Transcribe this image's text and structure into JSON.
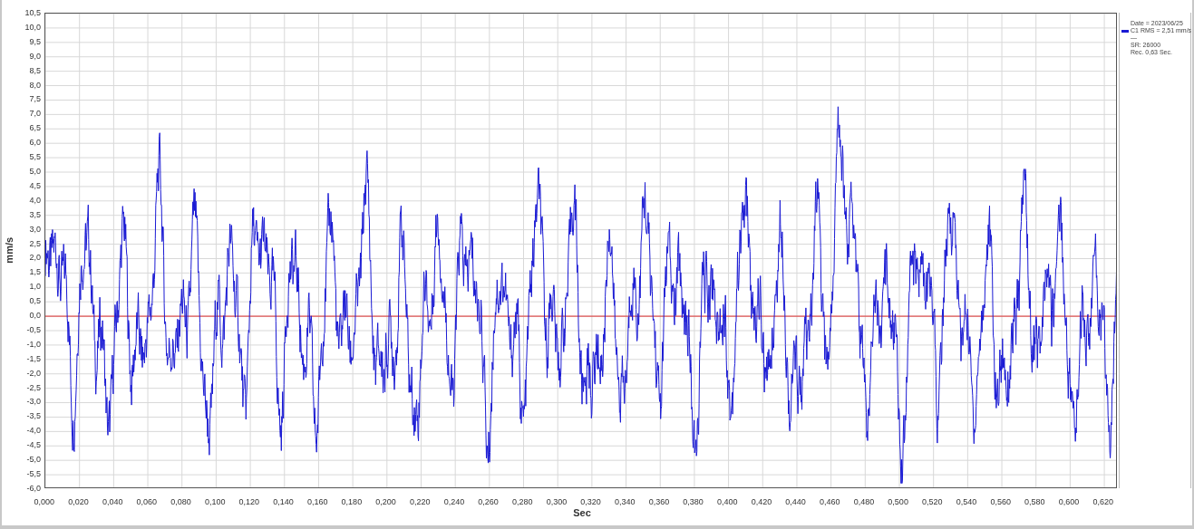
{
  "y_axis": {
    "title": "mm/s",
    "ticks": [
      "10,5",
      "10,0",
      "9,5",
      "9,0",
      "8,5",
      "8,0",
      "7,5",
      "7,0",
      "6,5",
      "6,0",
      "5,5",
      "5,0",
      "4,5",
      "4,0",
      "3,5",
      "3,0",
      "2,5",
      "2,0",
      "1,5",
      "1,0",
      "0,5",
      "0,0",
      "-0,5",
      "-1,0",
      "-1,5",
      "-2,0",
      "-2,5",
      "-3,0",
      "-3,5",
      "-4,0",
      "-4,5",
      "-5,0",
      "-5,5",
      "-6,0"
    ]
  },
  "x_axis": {
    "title": "Sec",
    "ticks": [
      "0,000",
      "0,020",
      "0,040",
      "0,060",
      "0,080",
      "0,100",
      "0,120",
      "0,140",
      "0,160",
      "0,180",
      "0,200",
      "0,220",
      "0,240",
      "0,260",
      "0,280",
      "0,300",
      "0,320",
      "0,340",
      "0,360",
      "0,380",
      "0,400",
      "0,420",
      "0,440",
      "0,460",
      "0,480",
      "0,500",
      "0,520",
      "0,540",
      "0,560",
      "0,580",
      "0,600",
      "0,620"
    ]
  },
  "legend": {
    "color": "#1a1ad4",
    "lines": [
      "Date = 2023/06/25",
      "C1 RMS = 2,51 mm/s",
      "—",
      "SR: 26000",
      "Rec. 0,63 Sec."
    ]
  }
}
